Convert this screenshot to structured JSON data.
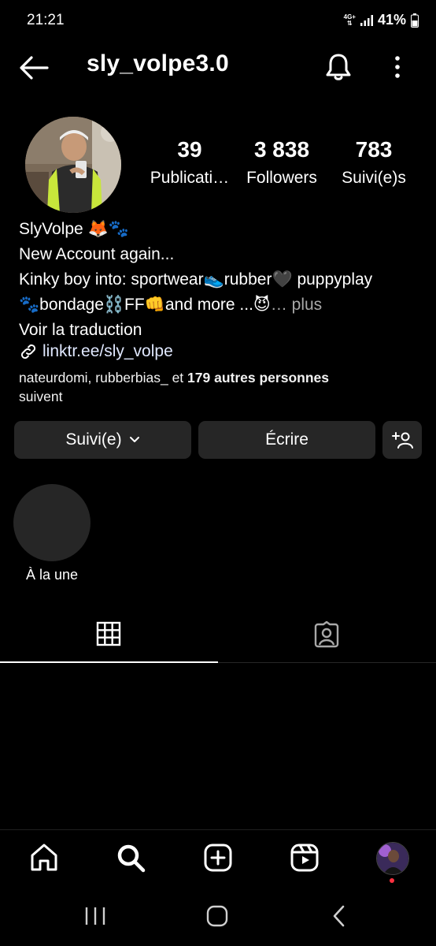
{
  "status_bar": {
    "time": "21:21",
    "network_top": "4G+",
    "battery": "41%"
  },
  "header": {
    "username": "sly_volpe3.0",
    "icons": [
      "back-arrow-icon",
      "bell-icon",
      "more-vertical-icon"
    ]
  },
  "stats": [
    {
      "value": "39",
      "label": "Publicati…"
    },
    {
      "value": "3 838",
      "label": "Followers"
    },
    {
      "value": "783",
      "label": "Suivi(e)s"
    }
  ],
  "bio": {
    "name": "SlyVolpe 🦊🐾",
    "line1": "New Account again...",
    "line2": "Kinky boy into: sportwear👟rubber🖤 puppyplay",
    "line3": "🐾bondage⛓️FF👊and more ...😈",
    "more": "… plus",
    "translate": "Voir la traduction",
    "link": "linktr.ee/sly_volpe",
    "followed_by_users": "nateurdomi, rubberbias_",
    "followed_by_and": " et ",
    "followed_by_count": "179 autres personnes",
    "followed_by_suffix": "suivent"
  },
  "buttons": {
    "following": "Suivi(e)",
    "message": "Écrire"
  },
  "highlight": {
    "label": "À la une"
  },
  "tabs": [
    "grid-icon",
    "tagged-icon"
  ],
  "bottom_nav": [
    "home-icon",
    "search-icon",
    "create-icon",
    "reels-icon",
    "profile-avatar"
  ],
  "colors": {
    "background": "#000000",
    "button": "#262626",
    "notification_dot": "#ff3040"
  }
}
